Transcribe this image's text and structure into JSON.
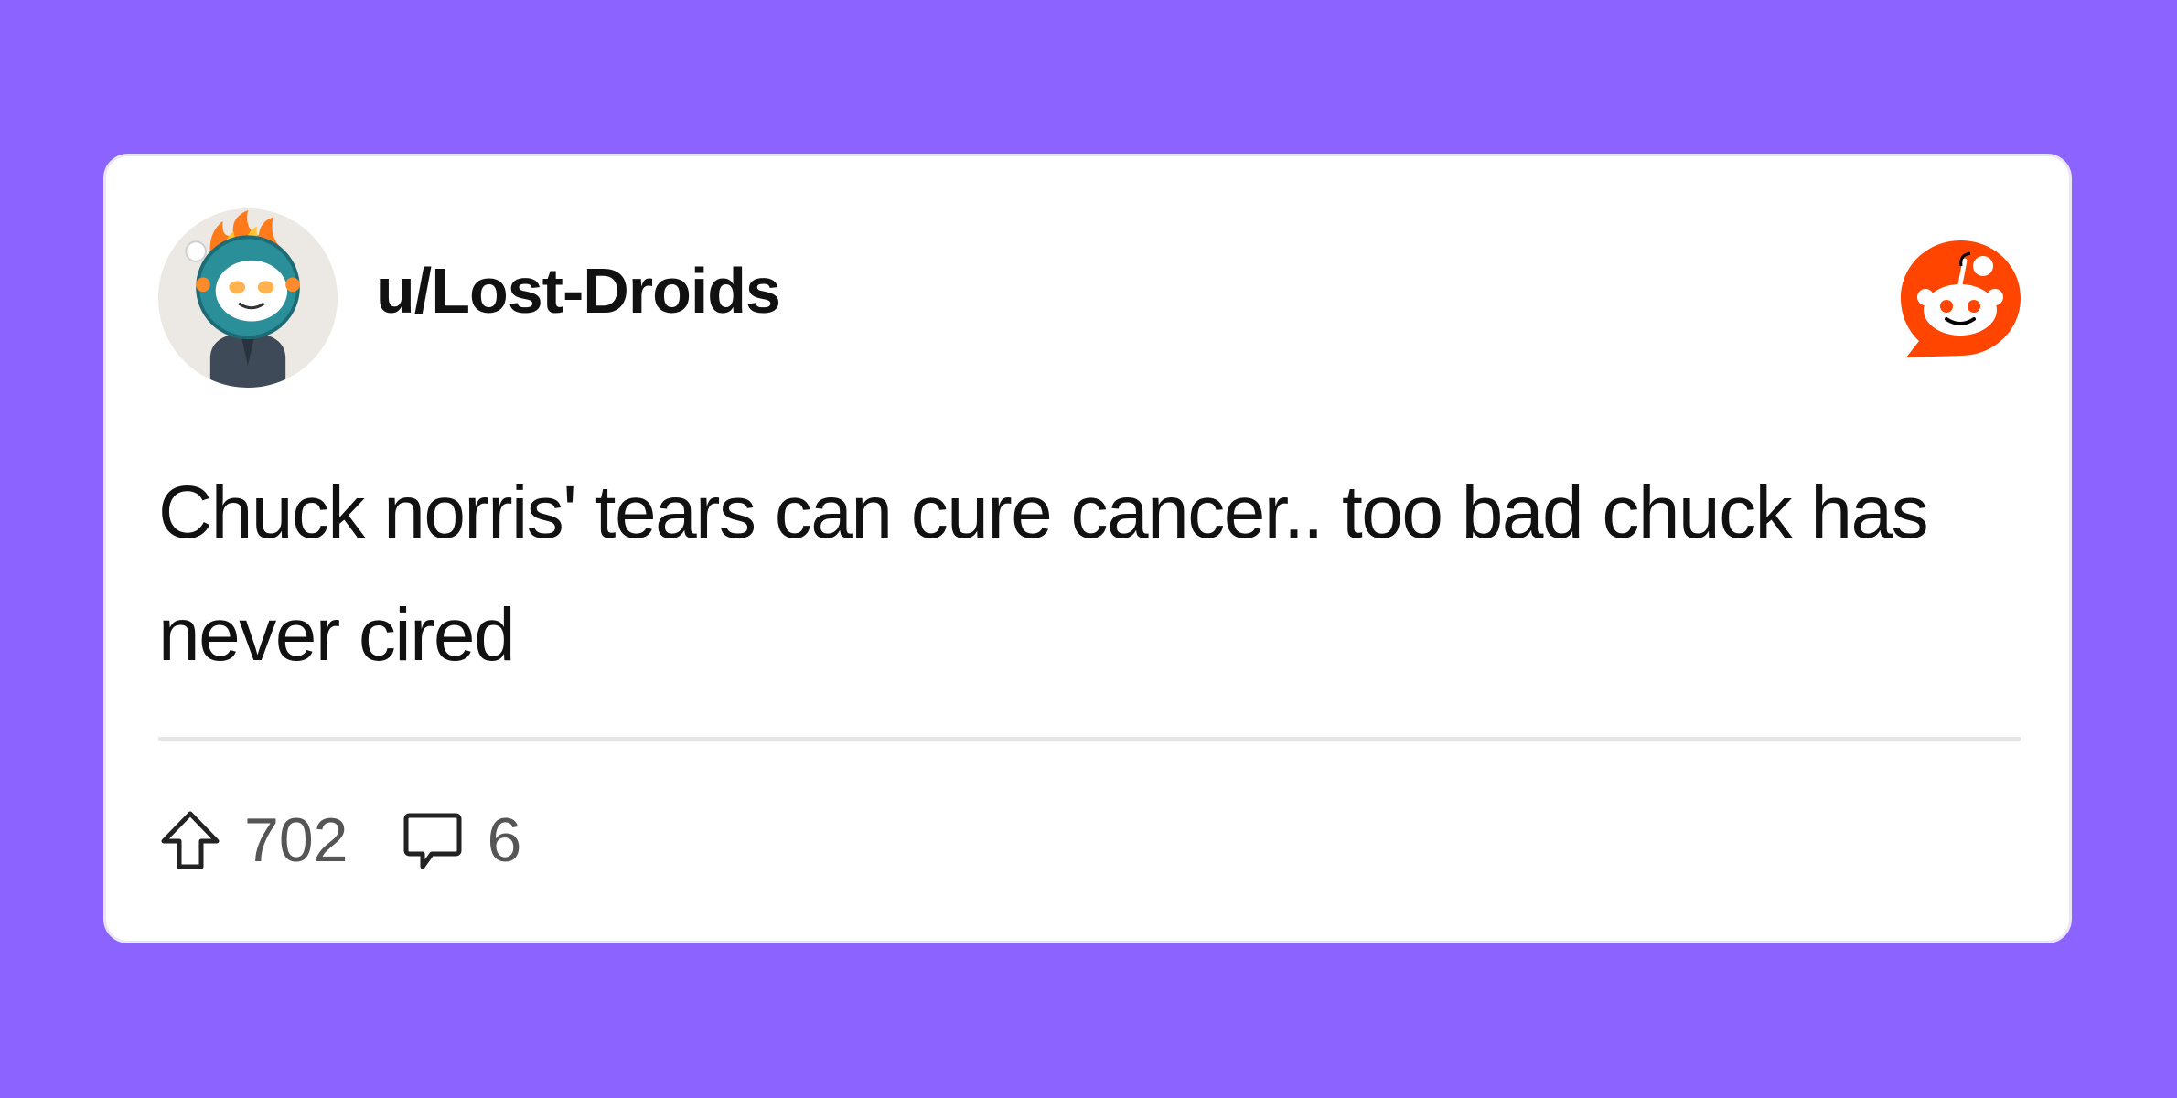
{
  "post": {
    "username": "u/Lost-Droids",
    "text": "Chuck norris' tears can cure cancer.. too bad chuck has never cired",
    "upvotes": "702",
    "comments": "6"
  },
  "icons": {
    "avatar": "reddit-snoo-astronaut-avatar",
    "logo": "reddit-logo-icon",
    "upvote": "upvote-arrow-icon",
    "comment": "comment-bubble-icon"
  },
  "colors": {
    "background": "#8c63ff",
    "card": "#ffffff",
    "reddit_orange": "#ff4500",
    "text": "#111111",
    "muted": "#555555"
  }
}
